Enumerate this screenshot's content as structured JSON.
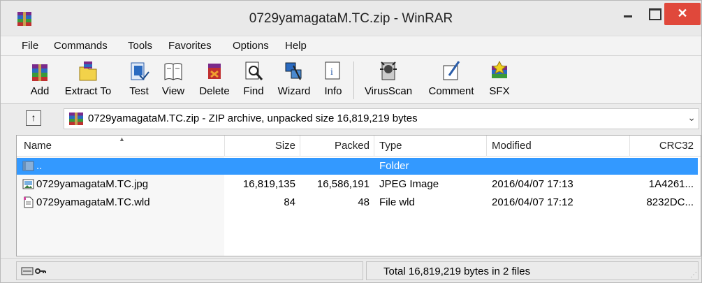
{
  "window": {
    "title": "0729yamagataM.TC.zip - WinRAR",
    "close_glyph": "✕"
  },
  "menu": [
    "File",
    "Commands",
    "Tools",
    "Favorites",
    "Options",
    "Help"
  ],
  "toolbar": [
    {
      "label": "Add",
      "icon": "add-icon"
    },
    {
      "label": "Extract To",
      "icon": "extract-to-icon"
    },
    {
      "label": "Test",
      "icon": "test-icon"
    },
    {
      "label": "View",
      "icon": "view-icon"
    },
    {
      "label": "Delete",
      "icon": "delete-icon"
    },
    {
      "label": "Find",
      "icon": "find-icon"
    },
    {
      "label": "Wizard",
      "icon": "wizard-icon"
    },
    {
      "label": "Info",
      "icon": "info-icon"
    },
    {
      "label": "VirusScan",
      "icon": "virusscan-icon"
    },
    {
      "label": "Comment",
      "icon": "comment-icon"
    },
    {
      "label": "SFX",
      "icon": "sfx-icon"
    }
  ],
  "pathbar": {
    "up_glyph": "↑",
    "text": "0729yamagataM.TC.zip - ZIP archive, unpacked size 16,819,219 bytes",
    "dropdown_glyph": "⌄"
  },
  "columns": {
    "name": "Name",
    "size": "Size",
    "packed": "Packed",
    "type": "Type",
    "modified": "Modified",
    "crc": "CRC32"
  },
  "rows": [
    {
      "name": "..",
      "size": "",
      "packed": "",
      "type": "Folder",
      "modified": "",
      "crc": "",
      "icon": "folder-icon",
      "selected": true
    },
    {
      "name": "0729yamagataM.TC.jpg",
      "size": "16,819,135",
      "packed": "16,586,191",
      "type": "JPEG Image",
      "modified": "2016/04/07 17:13",
      "crc": "1A4261...",
      "icon": "image-file-icon",
      "selected": false
    },
    {
      "name": "0729yamagataM.TC.wld",
      "size": "84",
      "packed": "48",
      "type": "File wld",
      "modified": "2016/04/07 17:12",
      "crc": "8232DC...",
      "icon": "text-file-icon",
      "selected": false
    }
  ],
  "status": {
    "total": "Total 16,819,219 bytes in 2 files"
  },
  "colors": {
    "selection": "#3399ff",
    "close": "#e0483b"
  }
}
